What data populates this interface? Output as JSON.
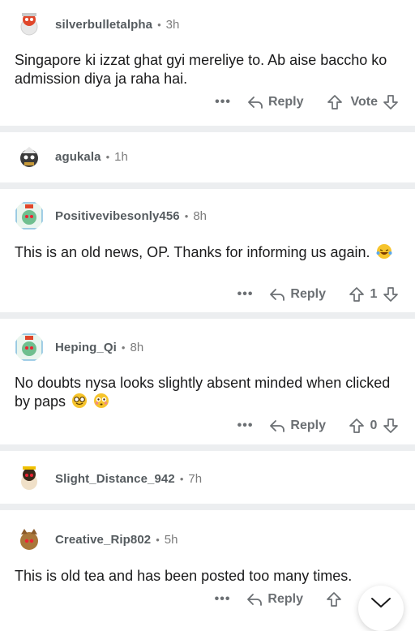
{
  "comments": [
    {
      "username": "silverbulletalpha",
      "time": "3h",
      "text": "Singapore ki izzat ghat gyi mereliye to. Ab aise baccho ko admission diya ja raha hai.",
      "more": "•••",
      "reply_label": "Reply",
      "vote_label": "Vote",
      "avatar_color": "#e0472b"
    },
    {
      "username": "agukala",
      "time": "1h",
      "avatar_color": "#3b3b3b"
    },
    {
      "username": "Positivevibesonly456",
      "time": "8h",
      "text": "This is an old news, OP. Thanks for informing us again.",
      "emoji": "laughing-crying",
      "more": "•••",
      "reply_label": "Reply",
      "vote_count": "1",
      "avatar_color": "#6fbf8f"
    },
    {
      "username": "Heping_Qi",
      "time": "8h",
      "text": "No doubts nysa looks slightly absent minded when clicked by paps",
      "emoji": "nerd-face, flushed-face",
      "more": "•••",
      "reply_label": "Reply",
      "vote_count": "0",
      "avatar_color": "#6fbf8f"
    },
    {
      "username": "Slight_Distance_942",
      "time": "7h",
      "avatar_color": "#f0c000"
    },
    {
      "username": "Creative_Rip802",
      "time": "5h",
      "text": "This is old tea and has been posted too many times.",
      "more": "•••",
      "reply_label": "Reply",
      "avatar_color": "#a9773a"
    }
  ],
  "separator_color": "#eceef0",
  "meta_dot": "•"
}
